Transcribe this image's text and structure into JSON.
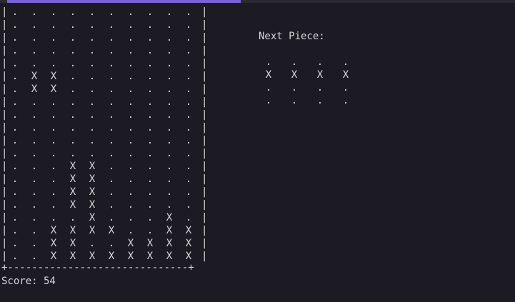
{
  "progress": 0.46,
  "board": {
    "rows": [
      "..........",
      "..........",
      "..........",
      "..........",
      "..........",
      ".XX.......",
      ".XX.......",
      "..........",
      "..........",
      "..........",
      "..........",
      "..........",
      "...XX.....",
      "...XX.....",
      "...XX.....",
      "...XX.....",
      "....X...X.",
      "..XXXX..XX",
      "..XX..XXXX",
      "..XXXXXXXX"
    ],
    "wall_char": "|",
    "bottom_border": "+------------------------------+"
  },
  "score": {
    "text": "Score: 54"
  },
  "next_piece": {
    "title": "Next Piece:",
    "rows": [
      "....",
      "XXXX",
      "....",
      "...."
    ]
  }
}
